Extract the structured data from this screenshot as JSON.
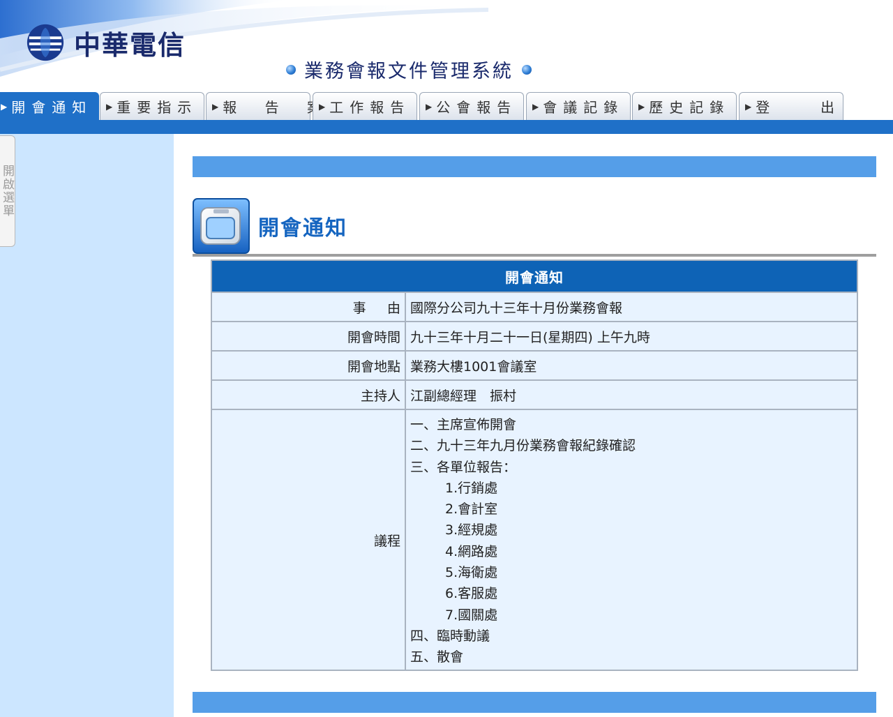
{
  "header": {
    "company_name": "中華電信",
    "system_title": "業務會報文件管理系統",
    "colors": {
      "brand": "#1a2a6c",
      "accent": "#1f70c8"
    }
  },
  "nav": {
    "tabs": [
      {
        "label": "開會通知",
        "active": true
      },
      {
        "label": "重要指示",
        "active": false
      },
      {
        "label": "報 告 案",
        "active": false
      },
      {
        "label": "工作報告",
        "active": false
      },
      {
        "label": "公會報告",
        "active": false
      },
      {
        "label": "會議記錄",
        "active": false
      },
      {
        "label": "歷史記錄",
        "active": false
      },
      {
        "label": "登  出",
        "active": false
      }
    ]
  },
  "sidebar": {
    "toggle_label": "開啟選單"
  },
  "page": {
    "title": "開會通知"
  },
  "notice": {
    "title": "開會通知",
    "rows": [
      {
        "label": "事由",
        "value": "國際分公司九十三年十月份業務會報"
      },
      {
        "label": "開會時間",
        "value": "九十三年十月二十一日(星期四) 上午九時"
      },
      {
        "label": "開會地點",
        "value": "業務大樓1001會議室"
      },
      {
        "label": "主持人",
        "value": "江副總經理　振村"
      }
    ],
    "agenda_label": "議程",
    "agenda": [
      {
        "text": "一、主席宣佈開會",
        "sub": false
      },
      {
        "text": "二、九十三年九月份業務會報紀錄確認",
        "sub": false
      },
      {
        "text": "三、各單位報告：",
        "sub": false
      },
      {
        "text": "1.行銷處",
        "sub": true
      },
      {
        "text": "2.會計室",
        "sub": true
      },
      {
        "text": "3.經規處",
        "sub": true
      },
      {
        "text": "4.網路處",
        "sub": true
      },
      {
        "text": "5.海衛處",
        "sub": true
      },
      {
        "text": "6.客服處",
        "sub": true
      },
      {
        "text": "7.國關處",
        "sub": true
      },
      {
        "text": "四、臨時動議",
        "sub": false
      },
      {
        "text": "五、散會",
        "sub": false
      }
    ]
  }
}
